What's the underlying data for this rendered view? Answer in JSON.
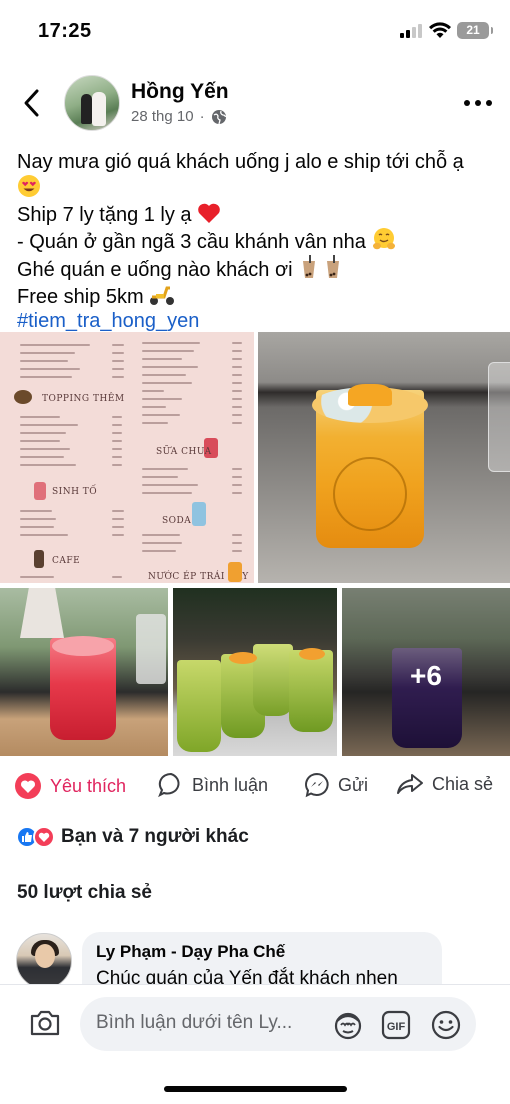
{
  "status_bar": {
    "time": "17:25",
    "battery": "21"
  },
  "post": {
    "author": "Hồng Yến",
    "date": "28 thg 10",
    "dot": "·",
    "caption": {
      "line1": "Nay mưa gió quá khách uống j alo e ship tới chỗ ạ",
      "line2": "Ship 7 ly tặng 1 ly ạ",
      "line3": "- Quán ở gần ngã 3 cầu khánh vân nha",
      "line4": "Ghé quán e uống nào khách ơi",
      "line5": "Free ship 5km",
      "hashtag": "#tiem_tra_hong_yen"
    },
    "more_photos": "+6"
  },
  "actions": {
    "like": "Yêu thích",
    "comment": "Bình luận",
    "send": "Gửi",
    "share": "Chia sẻ"
  },
  "reactions_text": "Bạn và 7 người khác",
  "shares_text": "50 lượt chia sẻ",
  "comment": {
    "author": "Ly Phạm - Dạy Pha Chế",
    "text": "Chúc quán của Yến đắt khách nhen"
  },
  "composer": {
    "placeholder": "Bình luận dưới tên Ly..."
  },
  "colors": {
    "like": "#e0245e",
    "hashtag": "#1a5fc8",
    "secondary": "#65676b"
  },
  "icons": [
    "back-arrow-icon",
    "globe-icon",
    "more-icon",
    "heart-icon",
    "comment-icon",
    "messenger-icon",
    "share-icon",
    "camera-icon",
    "avatar-sticker-icon",
    "gif-icon",
    "emoji-icon"
  ]
}
